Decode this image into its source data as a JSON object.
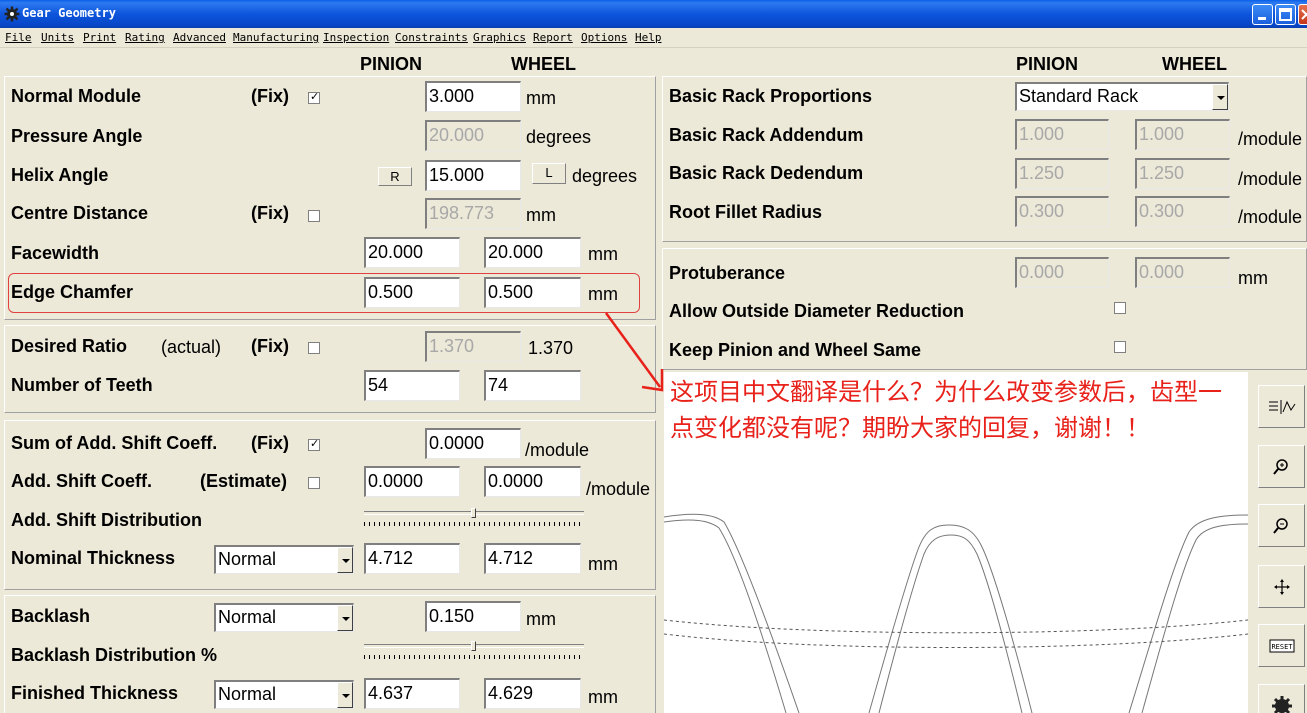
{
  "window": {
    "title": "Gear Geometry"
  },
  "menu": [
    "File",
    "Units",
    "Print",
    "Rating",
    "Advanced",
    "Manufacturing",
    "Inspection",
    "Constraints",
    "Graphics",
    "Report",
    "Options",
    "Help"
  ],
  "headers": {
    "pinion": "PINION",
    "wheel": "WHEEL"
  },
  "units": {
    "mm": "mm",
    "degrees": "degrees",
    "per_module": "/module"
  },
  "left": {
    "normal_module": {
      "label": "Normal Module",
      "fix": "(Fix)",
      "value": "3.000",
      "checked": true
    },
    "pressure_angle": {
      "label": "Pressure Angle",
      "value": "20.000"
    },
    "helix_angle": {
      "label": "Helix Angle",
      "r_button": "R",
      "value": "15.000",
      "l_button": "L"
    },
    "centre_distance": {
      "label": "Centre Distance",
      "fix": "(Fix)",
      "value": "198.773",
      "checked": false
    },
    "facewidth": {
      "label": "Facewidth",
      "pinion": "20.000",
      "wheel": "20.000"
    },
    "edge_chamfer": {
      "label": "Edge Chamfer",
      "pinion": "0.500",
      "wheel": "0.500"
    },
    "desired_ratio": {
      "label": "Desired Ratio",
      "actual": "(actual)",
      "fix": "(Fix)",
      "value": "1.370",
      "actual_value": "1.370",
      "checked": false
    },
    "number_of_teeth": {
      "label": "Number of Teeth",
      "pinion": "54",
      "wheel": "74"
    },
    "sum_add_shift": {
      "label": "Sum of Add. Shift Coeff.",
      "fix": "(Fix)",
      "value": "0.0000",
      "checked": true
    },
    "add_shift": {
      "label": "Add. Shift Coeff.",
      "estimate": "(Estimate)",
      "pinion": "0.0000",
      "wheel": "0.0000",
      "checked": false
    },
    "add_shift_distribution": {
      "label": "Add. Shift Distribution",
      "level_percent": 50
    },
    "nominal_thickness": {
      "label": "Nominal Thickness",
      "mode": "Normal",
      "pinion": "4.712",
      "wheel": "4.712"
    },
    "backlash": {
      "label": "Backlash",
      "mode": "Normal",
      "value": "0.150"
    },
    "backlash_distribution": {
      "label": "Backlash Distribution %",
      "level_percent": 50
    },
    "finished_thickness": {
      "label": "Finished Thickness",
      "mode": "Normal",
      "pinion": "4.637",
      "wheel": "4.629"
    }
  },
  "right": {
    "basic_rack_proportions": {
      "label": "Basic Rack Proportions",
      "value": "Standard Rack"
    },
    "basic_rack_addendum": {
      "label": "Basic Rack Addendum",
      "pinion": "1.000",
      "wheel": "1.000"
    },
    "basic_rack_dedendum": {
      "label": "Basic Rack Dedendum",
      "pinion": "1.250",
      "wheel": "1.250"
    },
    "root_fillet_radius": {
      "label": "Root Fillet Radius",
      "pinion": "0.300",
      "wheel": "0.300"
    },
    "protuberance": {
      "label": "Protuberance",
      "pinion": "0.000",
      "wheel": "0.000"
    },
    "allow_od_reduction": {
      "label": "Allow Outside Diameter Reduction",
      "checked": false
    },
    "keep_same": {
      "label": "Keep Pinion and Wheel Same",
      "checked": false
    }
  },
  "annotation": {
    "text": "这项目中文翻译是什么？为什么改变参数后，齿型一点变化都没有呢？期盼大家的回复，谢谢！！",
    "color": "#E8211A"
  },
  "toolbar_icons": [
    "chart-icon",
    "zoom-in-icon",
    "zoom-out-icon",
    "pan-icon",
    "reset-icon",
    "gear-icon"
  ],
  "tool_labels": {
    "reset": "RESET"
  }
}
